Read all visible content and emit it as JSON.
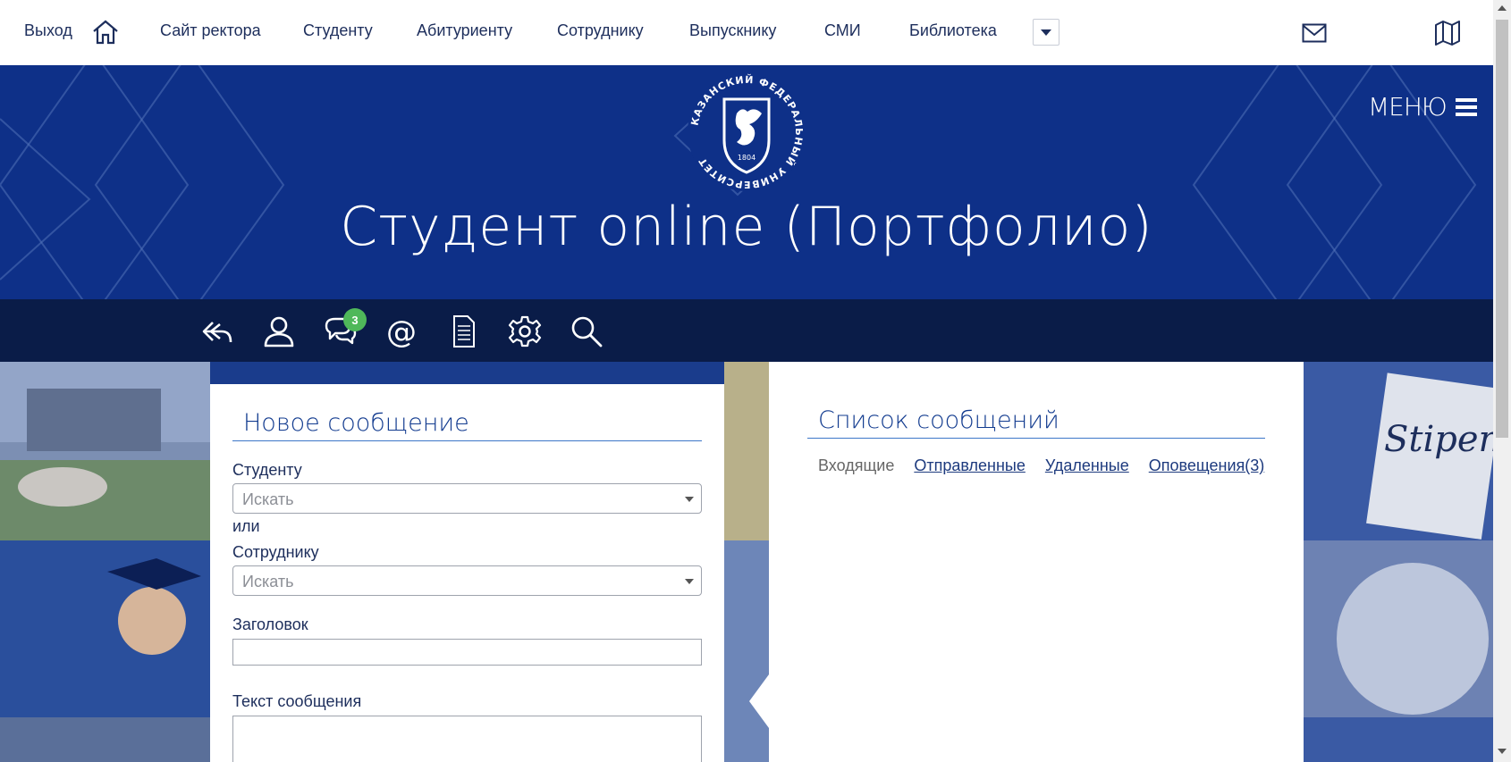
{
  "topnav": {
    "logout": "Выход",
    "home_icon": "home-icon",
    "items": [
      "Сайт ректора",
      "Студенту",
      "Абитуриенту",
      "Сотруднику",
      "Выпускнику",
      "СМИ",
      "Библиотека"
    ],
    "mail_icon": "mail-icon",
    "map_icon": "map-icon"
  },
  "hero": {
    "logo_ring_text": "КАЗАНСКИЙ ФЕДЕРАЛЬНЫЙ УНИВЕРСИТЕТ",
    "logo_year": "1804",
    "title": "Студент online (Портфолио)",
    "menu_label": "МЕНЮ"
  },
  "toolbar": {
    "icons": [
      "back-icon",
      "profile-icon",
      "messages-icon",
      "email-icon",
      "document-icon",
      "settings-icon",
      "search-icon"
    ],
    "messages_badge": "3",
    "at_symbol": "@"
  },
  "new_message": {
    "title": "Новое сообщение",
    "student_label": "Студенту",
    "student_placeholder": "Искать",
    "or_label": "или",
    "employee_label": "Сотруднику",
    "employee_placeholder": "Искать",
    "subject_label": "Заголовок",
    "subject_value": "",
    "body_label": "Текст сообщения",
    "body_value": ""
  },
  "message_list": {
    "title": "Список сообщений",
    "tabs": [
      {
        "label": "Входящие",
        "active": true
      },
      {
        "label": "Отправленные",
        "active": false
      },
      {
        "label": "Удаленные",
        "active": false
      },
      {
        "label": "Оповещения(3)",
        "active": false
      }
    ]
  },
  "colors": {
    "hero_blue": "#0e3088",
    "toolbar_navy": "#0a1c48",
    "badge_green": "#4fb85a",
    "link_blue": "#1d3a7e"
  }
}
